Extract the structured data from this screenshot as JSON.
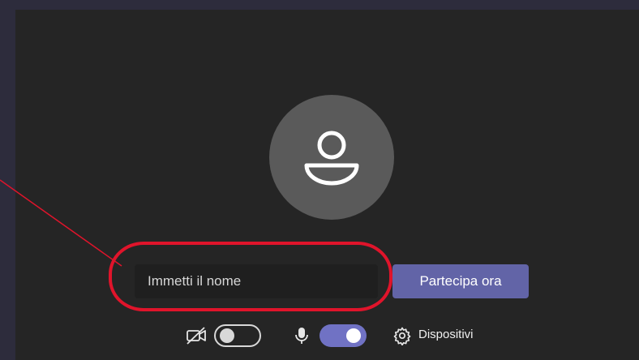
{
  "join_form": {
    "name_placeholder": "Immetti il nome",
    "name_value": "",
    "join_label": "Partecipa ora"
  },
  "controls": {
    "camera": {
      "icon": "camera-off-icon",
      "enabled": false
    },
    "microphone": {
      "icon": "microphone-icon",
      "enabled": true
    },
    "devices": {
      "icon": "gear-icon",
      "label": "Dispositivi"
    }
  },
  "avatar": {
    "icon": "person-icon"
  },
  "annotation": {
    "color": "#e0142b"
  },
  "colors": {
    "accent": "#6264a7",
    "toggle_on": "#7072c4",
    "panel": "#252525",
    "frame": "#2d2c3c"
  }
}
